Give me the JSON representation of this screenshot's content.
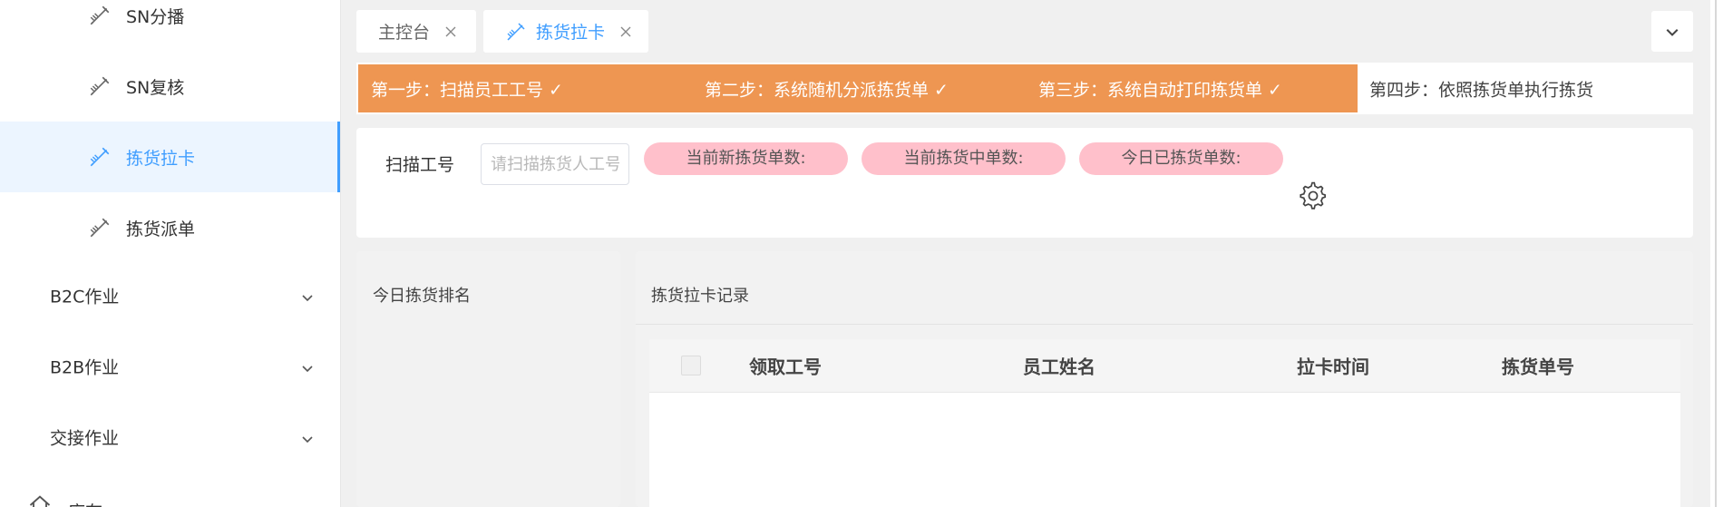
{
  "sidebar": {
    "sub_items": [
      {
        "label": "SN分播",
        "icon": "pencil-ruler-icon",
        "active": false
      },
      {
        "label": "SN复核",
        "icon": "pencil-ruler-icon",
        "active": false
      },
      {
        "label": "拣货拉卡",
        "icon": "pencil-ruler-icon",
        "active": true
      },
      {
        "label": "拣货派单",
        "icon": "pencil-ruler-icon",
        "active": false
      }
    ],
    "groups": [
      {
        "label": "B2C作业",
        "icon": "chevron-down-icon"
      },
      {
        "label": "B2B作业",
        "icon": "chevron-down-icon"
      },
      {
        "label": "交接作业",
        "icon": "chevron-down-icon"
      }
    ],
    "last_item": {
      "label": "库存",
      "icon": "home-icon"
    }
  },
  "tabs": [
    {
      "label": "主控台",
      "active": false,
      "icon": "close-icon"
    },
    {
      "label": "拣货拉卡",
      "active": true,
      "icon": "pencil-ruler-icon"
    }
  ],
  "tab_more_icon": "chevron-down-icon",
  "steps": {
    "step1": "第一步：扫描员工工号 ✓",
    "step2": "第二步：系统随机分派拣货单 ✓",
    "step3": "第三步：系统自动打印拣货单 ✓",
    "step4": "第四步：依照拣货单执行拣货"
  },
  "scan": {
    "label": "扫描工号",
    "placeholder": "请扫描拣货人工号",
    "value": "",
    "stats": [
      "当前新拣货单数:",
      "当前拣货中单数:",
      "今日已拣货单数:"
    ],
    "settings_icon": "gear-icon"
  },
  "ranking": {
    "title": "今日拣货排名"
  },
  "records": {
    "title": "拣货拉卡记录",
    "columns": [
      "领取工号",
      "员工姓名",
      "拉卡时间",
      "拣货单号"
    ],
    "rows": []
  },
  "colors": {
    "accent": "#409eff",
    "steps_done": "#ee9652",
    "stat_pill": "#ffc0cb"
  }
}
